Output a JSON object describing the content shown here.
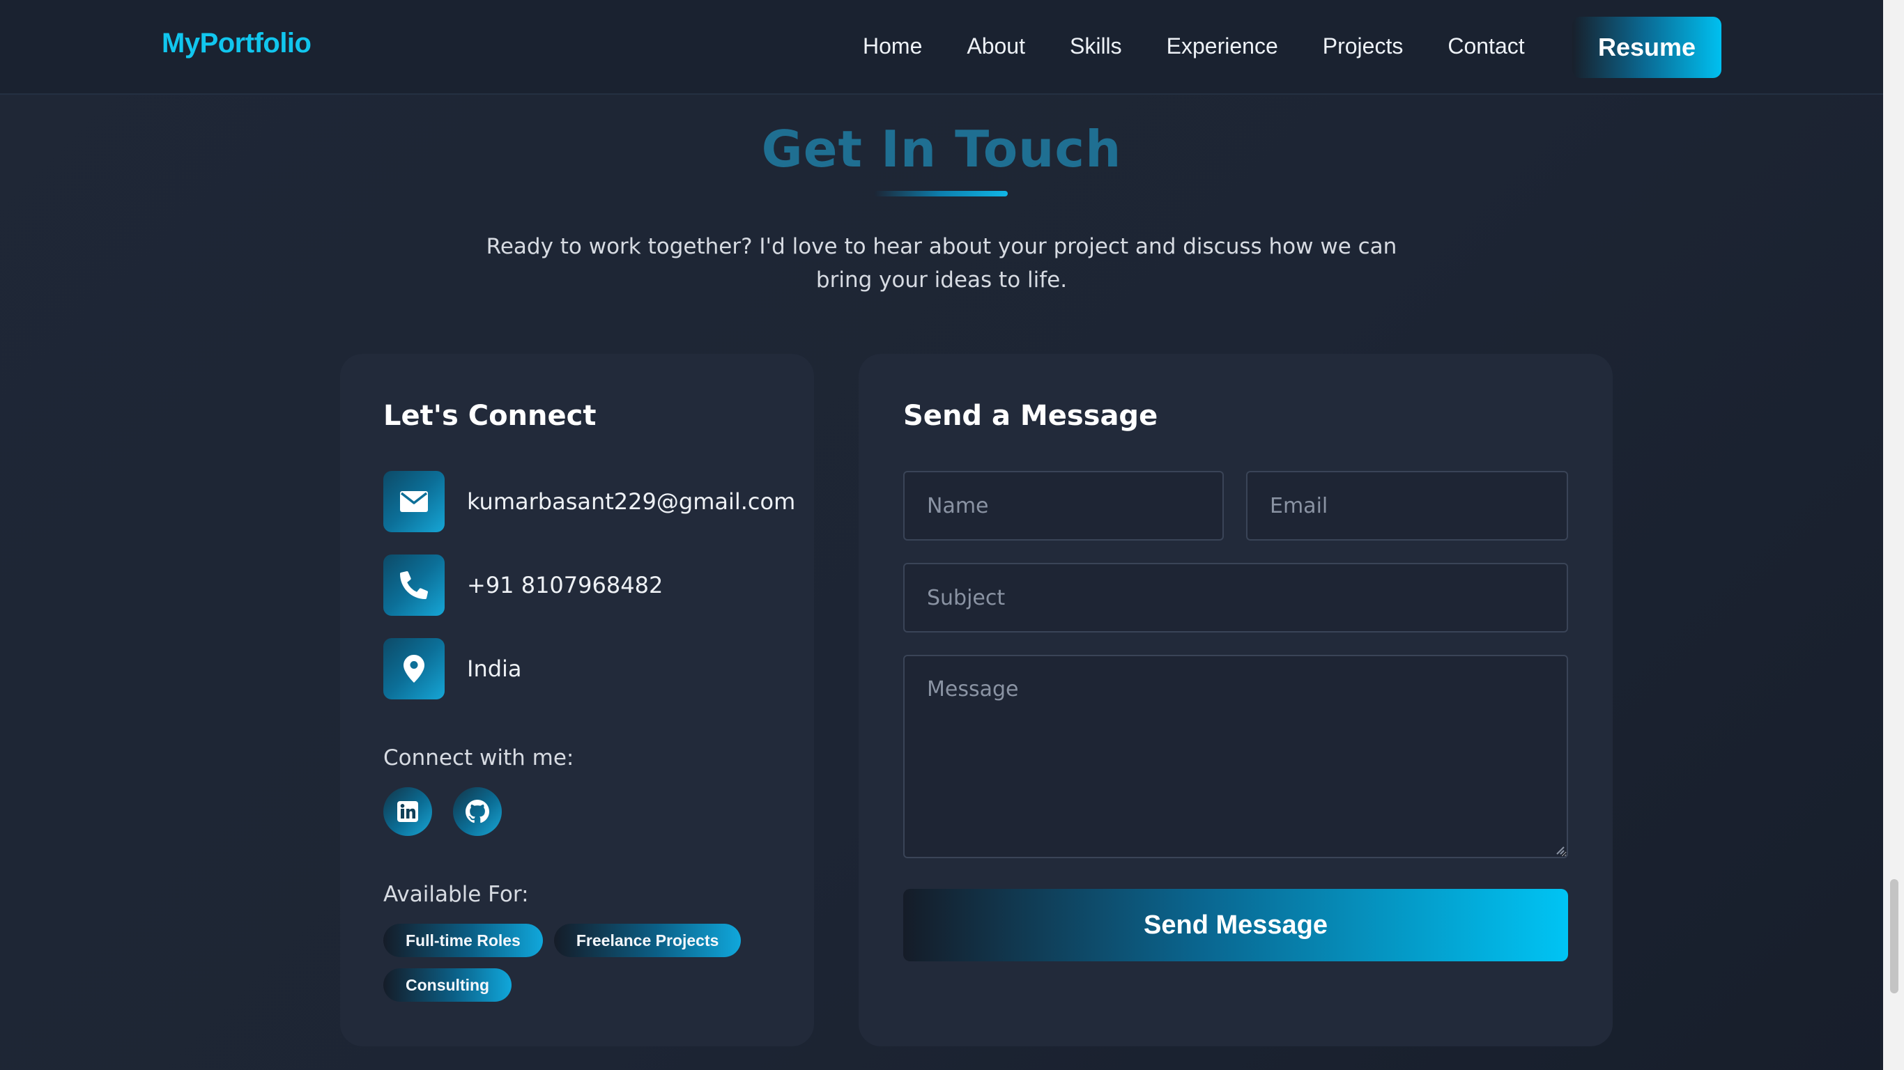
{
  "nav": {
    "brand": "MyPortfolio",
    "links": [
      {
        "label": "Home"
      },
      {
        "label": "About"
      },
      {
        "label": "Skills"
      },
      {
        "label": "Experience"
      },
      {
        "label": "Projects"
      },
      {
        "label": "Contact"
      }
    ],
    "resume_label": "Resume"
  },
  "section": {
    "title": "Get In Touch",
    "intro": "Ready to work together? I'd love to hear about your project and discuss how we can bring your ideas to life."
  },
  "connect": {
    "title": "Let's Connect",
    "email": "kumarbasant229@gmail.com",
    "phone": "+91 8107968482",
    "location": "India",
    "social_label": "Connect with me:",
    "social": [
      {
        "icon": "linkedin-icon"
      },
      {
        "icon": "github-icon"
      }
    ],
    "available_label": "Available For:",
    "tags": [
      "Full-time Roles",
      "Freelance Projects",
      "Consulting"
    ]
  },
  "form": {
    "title": "Send a Message",
    "name_placeholder": "Name",
    "email_placeholder": "Email",
    "subject_placeholder": "Subject",
    "message_placeholder": "Message",
    "submit_label": "Send Message"
  },
  "colors": {
    "accent": "#11c6ee",
    "title": "#1f6f92",
    "background": "#1f2736",
    "card": "#222a3a"
  }
}
